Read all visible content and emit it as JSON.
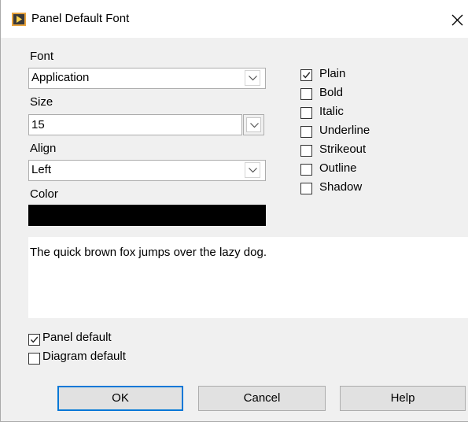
{
  "window": {
    "title": "Panel Default Font",
    "close_glyph": "✕",
    "app_icon": "labview-app-icon"
  },
  "font_section": {
    "label": "Font",
    "value": "Application"
  },
  "size_section": {
    "label": "Size",
    "value": "15"
  },
  "align_section": {
    "label": "Align",
    "value": "Left"
  },
  "color_section": {
    "label": "Color",
    "swatch_color": "#000000"
  },
  "styles": [
    {
      "label": "Plain",
      "checked": true
    },
    {
      "label": "Bold",
      "checked": false
    },
    {
      "label": "Italic",
      "checked": false
    },
    {
      "label": "Underline",
      "checked": false
    },
    {
      "label": "Strikeout",
      "checked": false
    },
    {
      "label": "Outline",
      "checked": false
    },
    {
      "label": "Shadow",
      "checked": false
    }
  ],
  "preview_text": "The quick brown fox jumps over the lazy dog.",
  "defaults": [
    {
      "label": "Panel default",
      "checked": true
    },
    {
      "label": "Diagram default",
      "checked": false
    }
  ],
  "buttons": {
    "ok": "OK",
    "cancel": "Cancel",
    "help": "Help"
  },
  "colors": {
    "dialog_bg": "#f0f0f0",
    "primary_border": "#0078d7",
    "button_bg": "#e1e1e1"
  }
}
